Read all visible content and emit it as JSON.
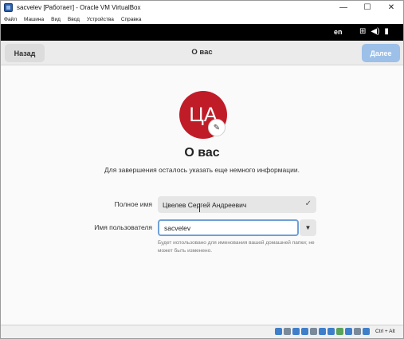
{
  "window": {
    "title": "sacvelev [Работает] - Oracle VM VirtualBox",
    "controls": {
      "minimize": "—",
      "maximize": "☐",
      "close": "✕"
    }
  },
  "menubar": {
    "items": [
      "Файл",
      "Машина",
      "Вид",
      "Ввод",
      "Устройства",
      "Справка"
    ]
  },
  "topbar": {
    "language": "en",
    "tray_icons": [
      "network-icon",
      "volume-icon",
      "battery-icon"
    ]
  },
  "header": {
    "back_label": "Назад",
    "title": "О вас",
    "next_label": "Далее"
  },
  "content": {
    "avatar_initials": "ЦА",
    "heading": "О вас",
    "subtitle": "Для завершения осталось указать еще немного информации.",
    "fullname_label": "Полное имя",
    "fullname_value": "Цвелев Сергей Андреевич",
    "username_label": "Имя пользователя",
    "username_value": "sacvelev",
    "username_hint": "Будет использовано для именования вашей домашней папки; не может быть изменено."
  },
  "statusbar": {
    "hostkey": "Ctrl + Alt"
  },
  "colors": {
    "avatar": "#c01c28",
    "next_button": "#9cc0e8",
    "focus_border": "#6fa0d8"
  }
}
